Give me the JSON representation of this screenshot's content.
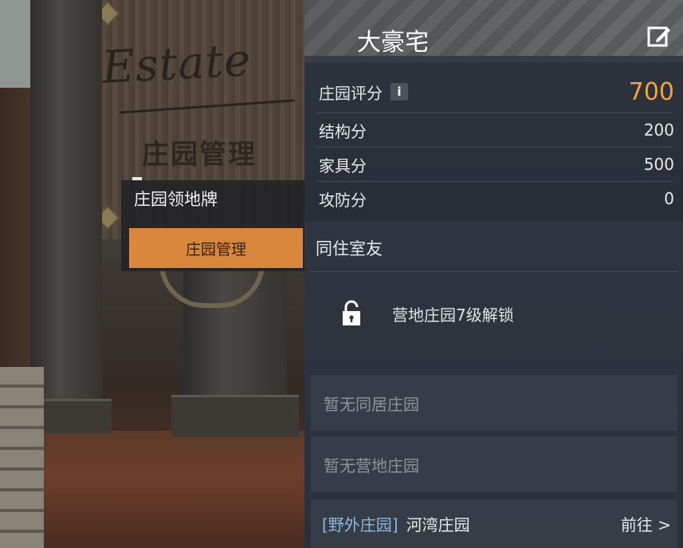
{
  "scene": {
    "sign_logo": "Estate",
    "sign_title": "庄园管理",
    "popup": {
      "title": "庄园领地牌",
      "button_label": "庄园管理"
    }
  },
  "panel": {
    "title": "大豪宅",
    "edit_icon": "edit-icon",
    "score": {
      "label": "庄园评分",
      "info_label": "i",
      "value": "700",
      "value_color": "#f0a43a"
    },
    "breakdown": [
      {
        "label": "结构分",
        "value": "200"
      },
      {
        "label": "家具分",
        "value": "500"
      },
      {
        "label": "攻防分",
        "value": "0"
      }
    ],
    "roommates": {
      "title": "同住室友",
      "lock_icon": "lock-icon",
      "lock_text": "营地庄园7级解锁"
    },
    "cohabit_empty": "暂无同居庄园",
    "camp_empty": "暂无营地庄园",
    "field_estate": {
      "tag": "[野外庄园]",
      "name": "河湾庄园",
      "goto_label": "前往 >",
      "tag_color": "#8fb6e0"
    }
  }
}
